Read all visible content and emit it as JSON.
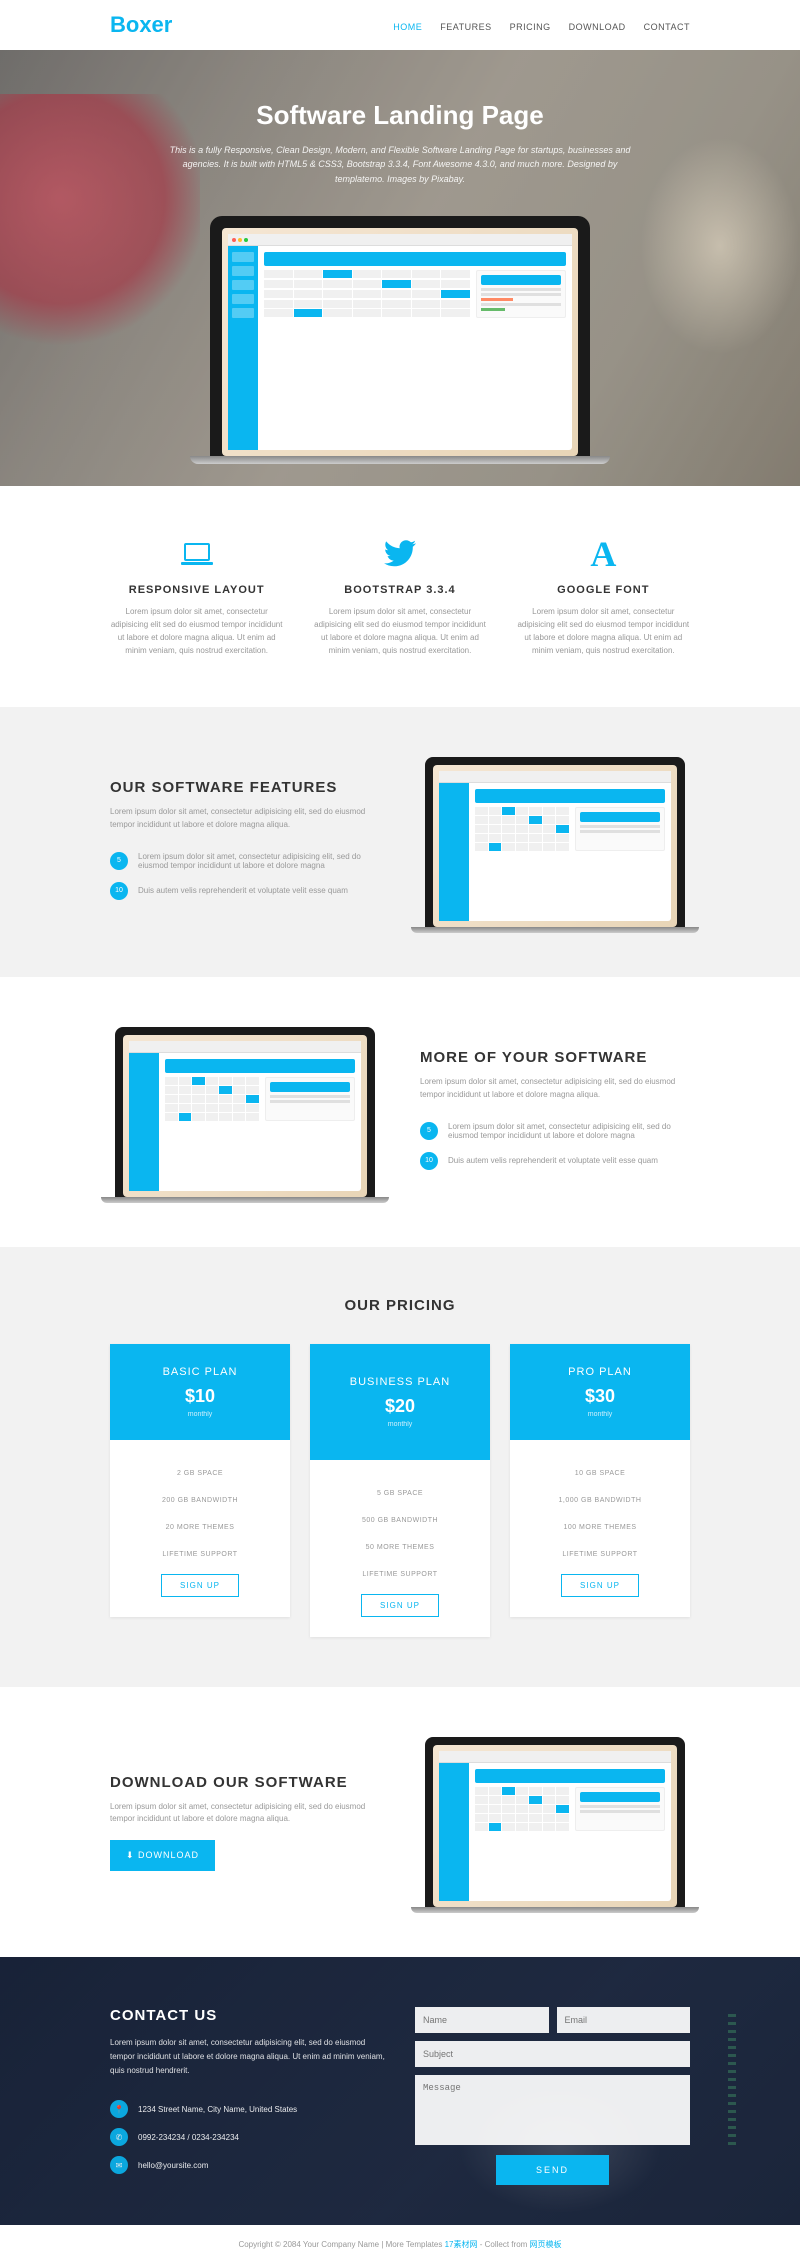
{
  "brand": "Boxer",
  "nav": [
    {
      "label": "HOME",
      "active": true
    },
    {
      "label": "FEATURES"
    },
    {
      "label": "PRICING"
    },
    {
      "label": "DOWNLOAD"
    },
    {
      "label": "CONTACT"
    }
  ],
  "hero": {
    "title": "Software Landing Page",
    "subtitle": "This is a fully Responsive, Clean Design, Modern, and Flexible Software Landing Page for startups, businesses and agencies. It is built with HTML5 & CSS3, Bootstrap 3.3.4, Font Awesome 4.3.0, and much more. Designed by templatemo. Images by Pixabay."
  },
  "features": [
    {
      "title": "RESPONSIVE LAYOUT",
      "desc": "Lorem ipsum dolor sit amet, consectetur adipisicing elit sed do eiusmod tempor incididunt ut labore et dolore magna aliqua. Ut enim ad minim veniam, quis nostrud exercitation."
    },
    {
      "title": "BOOTSTRAP 3.3.4",
      "desc": "Lorem ipsum dolor sit amet, consectetur adipisicing elit sed do eiusmod tempor incididunt ut labore et dolore magna aliqua. Ut enim ad minim veniam, quis nostrud exercitation."
    },
    {
      "title": "GOOGLE FONT",
      "desc": "Lorem ipsum dolor sit amet, consectetur adipisicing elit sed do eiusmod tempor incididunt ut labore et dolore magna aliqua. Ut enim ad minim veniam, quis nostrud exercitation."
    }
  ],
  "soft1": {
    "title": "OUR SOFTWARE FEATURES",
    "desc": "Lorem ipsum dolor sit amet, consectetur adipisicing elit, sed do eiusmod tempor incididunt ut labore et dolore magna aliqua.",
    "items": [
      {
        "n": "5",
        "text": "Lorem ipsum dolor sit amet, consectetur adipisicing elit, sed do eiusmod tempor incididunt ut labore et dolore magna"
      },
      {
        "n": "10",
        "text": "Duis autem velis reprehenderit et voluptate velit esse quam"
      }
    ]
  },
  "soft2": {
    "title": "MORE OF YOUR SOFTWARE",
    "desc": "Lorem ipsum dolor sit amet, consectetur adipisicing elit, sed do eiusmod tempor incididunt ut labore et dolore magna aliqua.",
    "items": [
      {
        "n": "5",
        "text": "Lorem ipsum dolor sit amet, consectetur adipisicing elit, sed do eiusmod tempor incididunt ut labore et dolore magna"
      },
      {
        "n": "10",
        "text": "Duis autem velis reprehenderit et voluptate velit esse quam"
      }
    ]
  },
  "pricing": {
    "title": "OUR PRICING",
    "plans": [
      {
        "name": "BASIC PLAN",
        "price": "$10",
        "period": "monthly",
        "feat": [
          "2 GB SPACE",
          "200 GB BANDWIDTH",
          "20 MORE THEMES",
          "LIFETIME SUPPORT"
        ],
        "btn": "SIGN UP"
      },
      {
        "name": "BUSINESS PLAN",
        "price": "$20",
        "period": "monthly",
        "feat": [
          "5 GB SPACE",
          "500 GB BANDWIDTH",
          "50 MORE THEMES",
          "LIFETIME SUPPORT"
        ],
        "btn": "SIGN UP",
        "featured": true
      },
      {
        "name": "PRO PLAN",
        "price": "$30",
        "period": "monthly",
        "feat": [
          "10 GB SPACE",
          "1,000 GB BANDWIDTH",
          "100 MORE THEMES",
          "LIFETIME SUPPORT"
        ],
        "btn": "SIGN UP"
      }
    ]
  },
  "download": {
    "title": "DOWNLOAD OUR SOFTWARE",
    "desc": "Lorem ipsum dolor sit amet, consectetur adipisicing elit, sed do eiusmod tempor incididunt ut labore et dolore magna aliqua.",
    "btn": "DOWNLOAD"
  },
  "contact": {
    "title": "CONTACT US",
    "desc": "Lorem ipsum dolor sit amet, consectetur adipisicing elit, sed do eiusmod tempor incididunt ut labore et dolore magna aliqua. Ut enim ad minim veniam, quis nostrud hendrerit.",
    "info": [
      {
        "icon": "📍",
        "text": "1234 Street Name, City Name, United States"
      },
      {
        "icon": "✆",
        "text": "0992-234234 / 0234-234234"
      },
      {
        "icon": "✉",
        "text": "hello@yoursite.com"
      }
    ],
    "placeholders": {
      "name": "Name",
      "email": "Email",
      "subject": "Subject",
      "message": "Message"
    },
    "send": "SEND"
  },
  "footer": {
    "text": "Copyright © 2084 Your Company Name | More Templates ",
    "link1": "17素材网",
    "mid": " - Collect from ",
    "link2": "网页模板"
  }
}
